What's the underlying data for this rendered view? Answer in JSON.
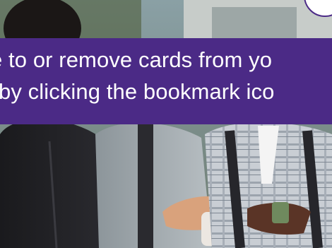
{
  "overlay": {
    "instruction_line_1": "e to or remove cards from yo",
    "instruction_line_2": "by clicking the bookmark ico"
  },
  "photo": {
    "subject": "group of students holding cups"
  },
  "colors": {
    "banner": "#4b2a86",
    "banner_text": "#ffffff",
    "badge_border": "#4b2a86"
  }
}
